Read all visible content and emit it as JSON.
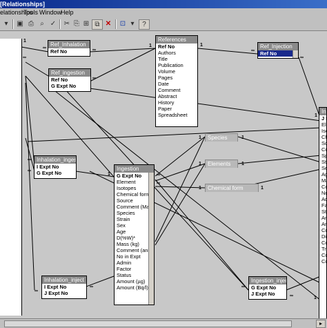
{
  "window": {
    "title": "[Relationships]"
  },
  "menu": [
    "elationships",
    "Tools",
    "Window",
    "Help"
  ],
  "toolbar": {
    "icons": [
      "dropdown-arrow-icon",
      "save-icon",
      "print-icon",
      "print-preview-icon",
      "spelling-icon",
      "cut-icon",
      "copy-icon",
      "paste-icon",
      "format-painter-icon",
      "show-table-icon",
      "show-direct-icon",
      "show-all-icon",
      "delete-icon",
      "relationships-icon",
      "new-object-icon",
      "help-icon"
    ],
    "glyphs": [
      "▾",
      "▣",
      "⎙",
      "⌕",
      "✓",
      "✂",
      "⎘",
      "▤",
      "✎",
      "⊞",
      "⊟",
      "⊠",
      "✕",
      "⧉",
      "⊡",
      "?"
    ]
  },
  "tables": {
    "ref_inhalation": {
      "title": "Ref_Inhalation",
      "fields": [
        "Ref No"
      ]
    },
    "ref_ingestion": {
      "title": "Ref_ingestion",
      "fields": [
        "Ref No",
        "G Expt No"
      ]
    },
    "references": {
      "title": "References",
      "fields": [
        "Ref No",
        "Authors",
        "Title",
        "Publication",
        "Volume",
        "Pages",
        "Date",
        "Comment",
        "Abstract",
        "History",
        "Paper",
        "Spreadsheet"
      ]
    },
    "ref_injection": {
      "title": "Ref_Injection",
      "fields": [
        "Ref No"
      ]
    },
    "inhalation_inge": {
      "title": "Inhalation_inges",
      "fields": [
        "I Expt No",
        "G Expt No"
      ]
    },
    "ingestion": {
      "title": "Ingestion",
      "fields": [
        "G Expt No",
        "Element",
        "Isotopes",
        "Chemical form",
        "Source",
        "Comment (Ma",
        "Species",
        "Strain",
        "Sex",
        "Age",
        "D(%W)*",
        "Mass (kg)",
        "Comment (ani",
        "No in Expt",
        "Admin",
        "Factor",
        "Status",
        "Amount (µg)",
        "Amount (Bq/l)"
      ]
    },
    "species": {
      "title": "Species"
    },
    "elements": {
      "title": "Elements"
    },
    "chemical_form": {
      "title": "Chemical form"
    },
    "inhalation_inject": {
      "title": "Inhalation_inject",
      "fields": [
        "I Expt No",
        "J Expt No"
      ]
    },
    "ingestion_inject": {
      "title": "Ingestion_inject",
      "fields": [
        "G Expt No",
        "J Expt No"
      ]
    },
    "injection": {
      "title": "Injectio",
      "fields": [
        "J E",
        "Elem",
        "Isoto",
        "Chen",
        "Sour",
        "Com",
        "Spe",
        "Stra",
        "Sex",
        "Age",
        "Mass",
        "Com",
        "No i",
        "Adm",
        "Fact",
        "Stat",
        "Amo",
        "Amo",
        "Cos",
        "Dist",
        "Co",
        "Tr",
        "Co",
        "Co"
      ]
    }
  },
  "cardinality": {
    "one": "1",
    "many": "∞"
  }
}
